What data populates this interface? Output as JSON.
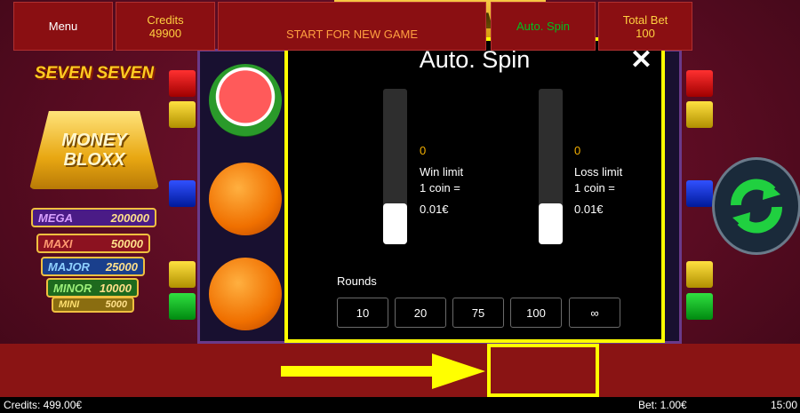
{
  "logo": {
    "line1": "SEVEN SEVEN",
    "line2a": "MONEY",
    "line2b": "BLOXX"
  },
  "jackpots": [
    {
      "name": "MEGA",
      "value": "200000"
    },
    {
      "name": "MAXI",
      "value": "50000"
    },
    {
      "name": "MAJOR",
      "value": "25000"
    },
    {
      "name": "MINOR",
      "value": "10000"
    },
    {
      "name": "MINI",
      "value": "5000"
    }
  ],
  "modal": {
    "title": "Auto. Spin",
    "close": "✕",
    "win": {
      "value": "0",
      "label": "Win limit",
      "coin": "1 coin =",
      "coin_value": "0.01€",
      "level": 0
    },
    "loss": {
      "value": "0",
      "label": "Loss limit",
      "coin": "1 coin =",
      "coin_value": "0.01€",
      "level": 0
    },
    "rounds_label": "Rounds",
    "rounds": [
      "10",
      "20",
      "75",
      "100",
      "∞"
    ]
  },
  "bottom": {
    "menu": "Menu",
    "credits_label": "Credits",
    "credits_value": "49900",
    "start_text": "START FOR NEW GAME",
    "autospin": "Auto. Spin",
    "totalbet_label": "Total Bet",
    "totalbet_value": "100"
  },
  "status": {
    "credits": "Credits: 499.00€",
    "bet": "Bet: 1.00€",
    "time": "15:00"
  },
  "colors": {
    "highlight": "#ffff00",
    "accent": "#f5b000",
    "autospin_text": "#00c020"
  }
}
